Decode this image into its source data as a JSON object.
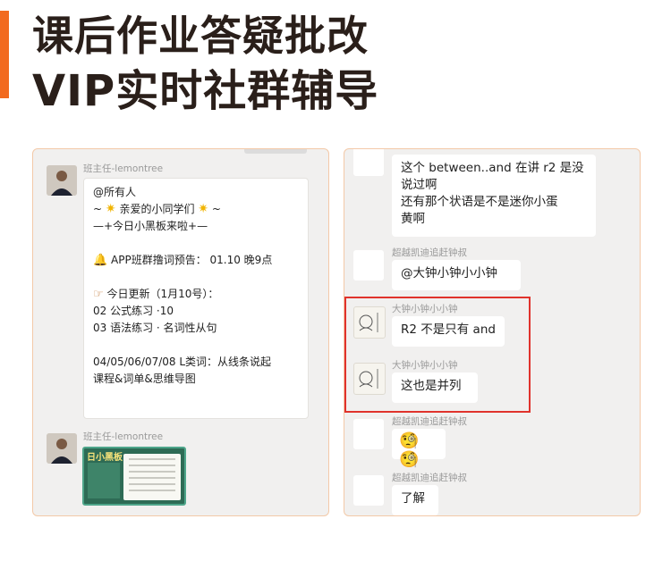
{
  "headline": {
    "line1": "课后作业答疑批改",
    "line2": "VIP实时社群辅导"
  },
  "colors": {
    "accent": "#f26a1f",
    "highlight_border": "#e0332c",
    "panel_border": "#f3c9a8"
  },
  "left_chat": {
    "messages": [
      {
        "sender": "班主任-lemontree",
        "lines": [
          "@所有人",
          "亲爱的小同学们",
          "—+今日小黑板来啦+—",
          "APP班群撸词预告： 01.10 晚9点",
          "今日更新（1月10号）：",
          "02 公式练习 ·10",
          "03 语法练习 · 名词性从句",
          "04/05/06/07/08 L类词：从线条说起",
          "课程&词单&思维导图"
        ]
      },
      {
        "sender": "班主任-lemontree",
        "image_title": "日小黑板"
      }
    ]
  },
  "right_chat": {
    "messages": [
      {
        "lines": [
          "这个 between..and 在讲 r2 是没",
          "说过啊",
          "还有那个状语是不是迷你小蛋",
          "黄啊"
        ]
      },
      {
        "sender": "超越凯迪追赶钟叔",
        "text": "@大钟小钟小小钟"
      },
      {
        "sender": "大钟小钟小小钟",
        "text": "R2 不是只有 and"
      },
      {
        "sender": "大钟小钟小小钟",
        "text": "这也是并列"
      },
      {
        "sender": "超越凯迪追赶钟叔",
        "emoji": "🧐🧐"
      },
      {
        "sender": "超越凯迪追赶钟叔",
        "text": "了解"
      }
    ]
  }
}
